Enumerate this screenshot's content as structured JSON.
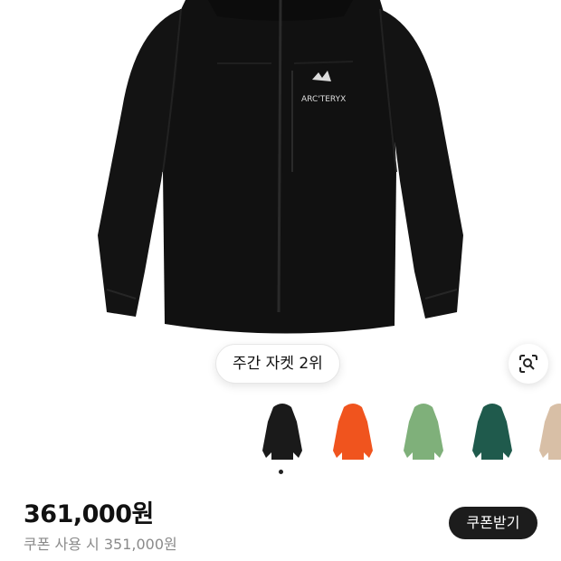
{
  "product": {
    "brand_logo_text": "ARC'TERYX",
    "rank_badge": "주간 자켓 2위"
  },
  "thumbnails": [
    {
      "name": "black",
      "color": "#1a1a1a",
      "selected": true
    },
    {
      "name": "orange",
      "color": "#f0541e",
      "selected": false
    },
    {
      "name": "sage",
      "color": "#7fb07a",
      "selected": false
    },
    {
      "name": "forest",
      "color": "#1f5a4c",
      "selected": false
    },
    {
      "name": "beige",
      "color": "#d8bfa6",
      "selected": false
    }
  ],
  "pricing": {
    "price": "361,000원",
    "coupon_price_text": "쿠폰 사용 시 351,000원",
    "coupon_button_label": "쿠폰받기"
  },
  "icons": {
    "visual_search": "lens-search-icon"
  }
}
